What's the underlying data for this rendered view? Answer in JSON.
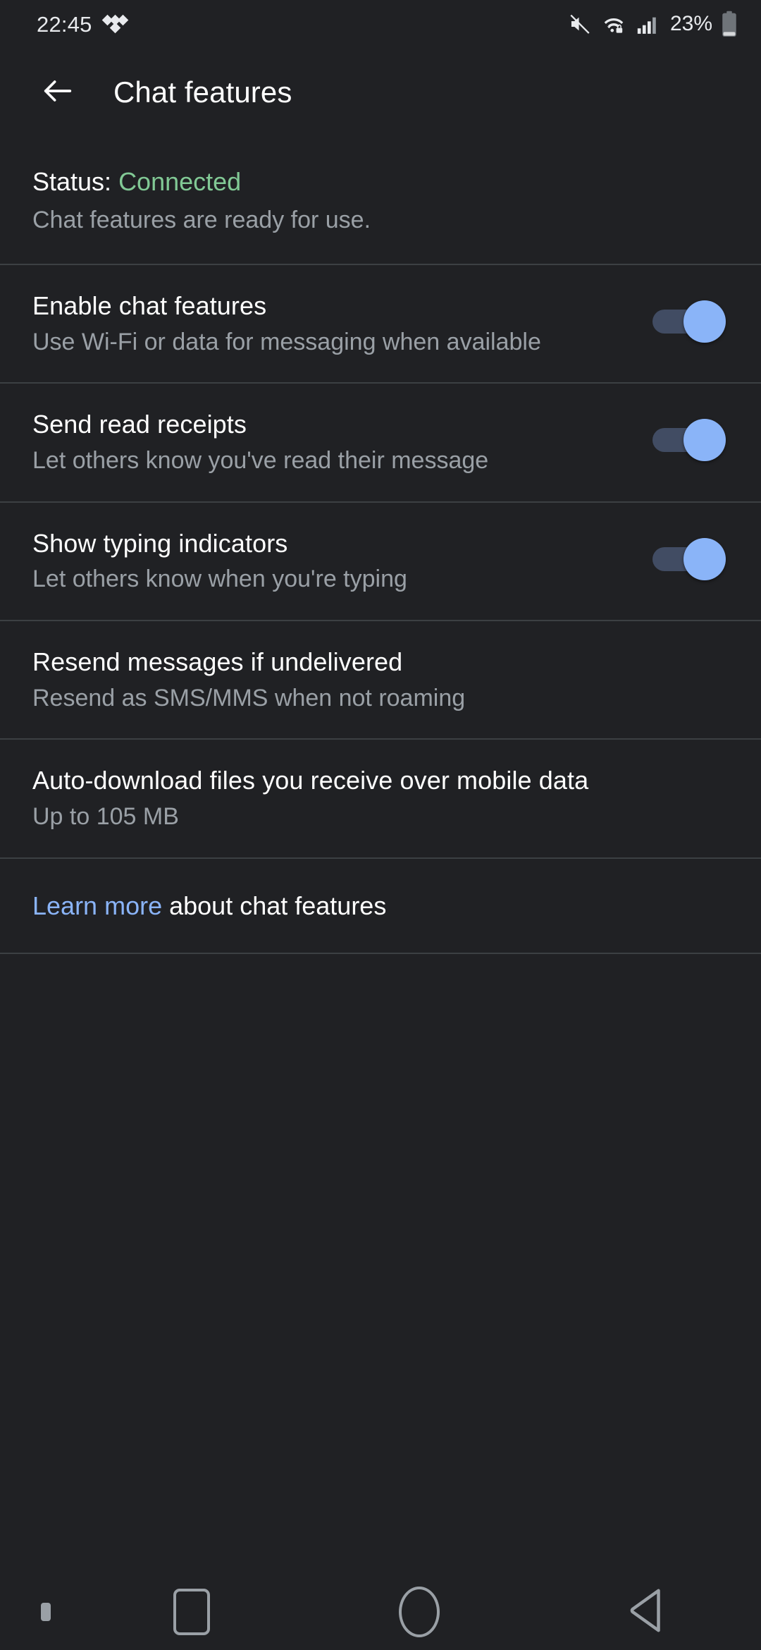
{
  "status_bar": {
    "clock": "22:45",
    "notification_icon": "tidal-icon",
    "icons": [
      "volume-muted-icon",
      "wifi-locked-icon",
      "cellular-signal-icon",
      "battery-icon"
    ],
    "battery_percent": "23%"
  },
  "app_bar": {
    "back_icon": "back-arrow-icon",
    "title": "Chat features"
  },
  "status_block": {
    "label": "Status: ",
    "value": "Connected",
    "value_color": "#81c995",
    "subtitle": "Chat features are ready for use."
  },
  "settings": [
    {
      "title": "Enable chat features",
      "subtitle": "Use Wi-Fi or data for messaging when available",
      "toggle": true,
      "toggle_state": "on"
    },
    {
      "title": "Send read receipts",
      "subtitle": "Let others know you've read their message",
      "toggle": true,
      "toggle_state": "on"
    },
    {
      "title": "Show typing indicators",
      "subtitle": "Let others know when you're typing",
      "toggle": true,
      "toggle_state": "on"
    },
    {
      "title": "Resend messages if undelivered",
      "subtitle": "Resend as SMS/MMS when not roaming",
      "toggle": false,
      "toggle_state": ""
    },
    {
      "title": "Auto-download files you receive over mobile data",
      "subtitle": "Up to 105 MB",
      "toggle": false,
      "toggle_state": ""
    }
  ],
  "learn_more": {
    "link": "Learn more",
    "rest": " about chat features",
    "link_color": "#8ab4f8"
  },
  "nav_bar": {
    "keyboard_indicator": "keyboard-indicator-icon",
    "recents": "recents-square-icon",
    "home": "home-circle-icon",
    "back": "back-triangle-icon"
  },
  "colors": {
    "background": "#202124",
    "divider": "#3c4043",
    "primary_text": "#ffffff",
    "secondary_text": "#9aa0a6",
    "accent": "#8ab4f8",
    "connected_green": "#81c995",
    "switch_track": "#414c63"
  }
}
